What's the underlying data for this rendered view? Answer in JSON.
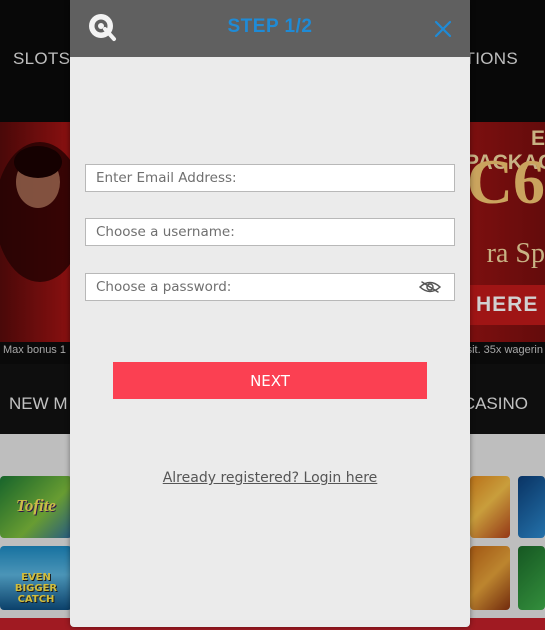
{
  "background": {
    "nav_left": "SLOTS",
    "nav_right": "TIONS",
    "promo_line1": "E PACKAG",
    "promo_line2": "C6",
    "promo_line3": "ra Sp",
    "promo_button": "HERE",
    "terms_left": "Max bonus 1",
    "terms_right": "sit. 35x wagerin",
    "category_left": "NEW  M",
    "category_right": "CASINO",
    "tile_1": "Tofite",
    "tile_2": "EVEN BIGGER CATCH"
  },
  "modal": {
    "title": "STEP 1/2",
    "email_placeholder": "Enter Email Address:",
    "username_placeholder": "Choose a username:",
    "password_placeholder": "Choose a password:",
    "next_label": "NEXT",
    "login_link": "Already registered? Login here"
  },
  "colors": {
    "title": "#1f8bd6",
    "next_button": "#fb4052",
    "header": "#606060"
  },
  "icons": {
    "logo": "brand-logo-icon",
    "close": "close-icon",
    "password_toggle": "eye-slash-icon"
  }
}
